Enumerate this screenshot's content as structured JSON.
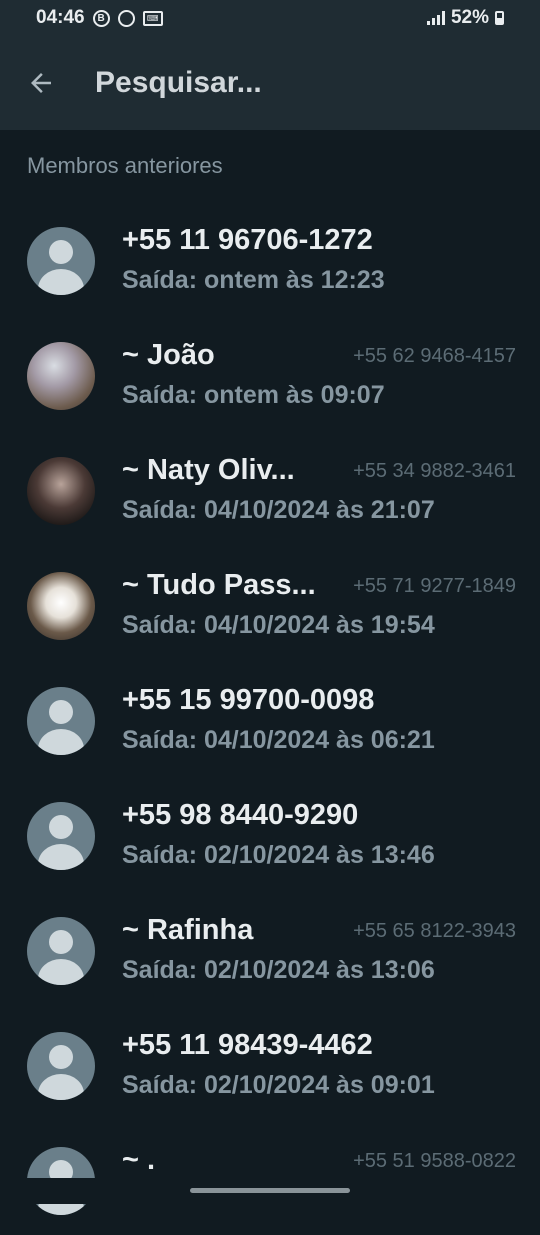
{
  "status": {
    "time": "04:46",
    "battery": "52%"
  },
  "appbar": {
    "search_label": "Pesquisar..."
  },
  "section": {
    "title": "Membros anteriores"
  },
  "members": [
    {
      "name": "+55 11 96706-1272",
      "phone": "",
      "left": "Saída: ontem às 12:23",
      "avatar": "default"
    },
    {
      "name": "~ João",
      "phone": "+55 62 9468-4157",
      "left": "Saída: ontem às 09:07",
      "avatar": "photo1"
    },
    {
      "name": "~ Naty Oliv...",
      "phone": "+55 34 9882-3461",
      "left": "Saída: 04/10/2024 às 21:07",
      "avatar": "photo2"
    },
    {
      "name": "~ Tudo Pass...",
      "phone": "+55 71 9277-1849",
      "left": "Saída: 04/10/2024 às 19:54",
      "avatar": "photo3"
    },
    {
      "name": "+55 15 99700-0098",
      "phone": "",
      "left": "Saída: 04/10/2024 às 06:21",
      "avatar": "default"
    },
    {
      "name": "+55 98 8440-9290",
      "phone": "",
      "left": "Saída: 02/10/2024 às 13:46",
      "avatar": "default"
    },
    {
      "name": "~ Rafinha",
      "phone": "+55 65 8122-3943",
      "left": "Saída: 02/10/2024 às 13:06",
      "avatar": "default"
    },
    {
      "name": "+55 11 98439-4462",
      "phone": "",
      "left": "Saída: 02/10/2024 às 09:01",
      "avatar": "default"
    },
    {
      "name": "~ .",
      "phone": "+55 51 9588-0822",
      "left": "",
      "avatar": "default"
    }
  ]
}
